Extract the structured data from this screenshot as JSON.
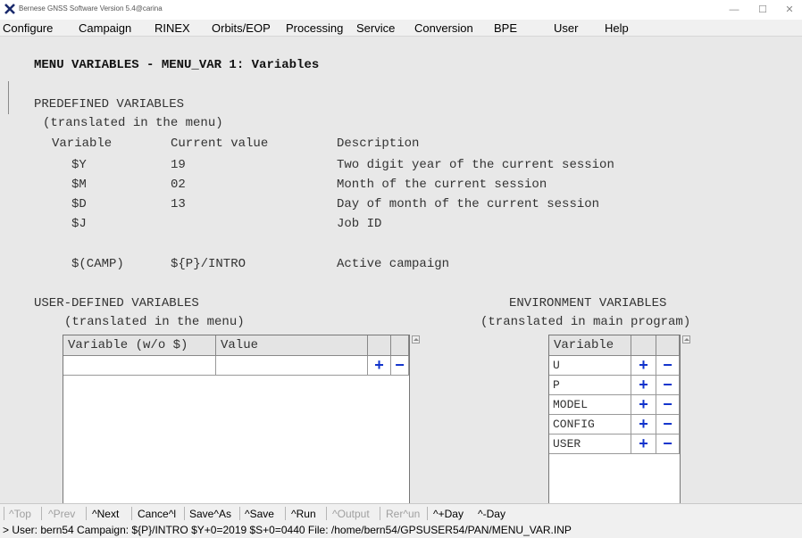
{
  "window": {
    "title": "Bernese GNSS Software Version 5.4@carina",
    "minimize": "—",
    "maximize": "☐",
    "close": "✕"
  },
  "menu": [
    "Configure",
    "Campaign",
    "RINEX",
    "Orbits/EOP",
    "Processing",
    "Service",
    "Conversion",
    "BPE",
    "User",
    "Help"
  ],
  "panel": {
    "title": "MENU VARIABLES - MENU_VAR 1: Variables",
    "predefined": {
      "heading": "PREDEFINED VARIABLES",
      "subheading": "(translated in the menu)",
      "col_variable": "Variable",
      "col_value": "Current value",
      "col_description": "Description",
      "rows": [
        {
          "variable": "$Y",
          "value": "19",
          "description": "Two digit year of the current session"
        },
        {
          "variable": "$M",
          "value": "02",
          "description": "Month of the current session"
        },
        {
          "variable": "$D",
          "value": "13",
          "description": "Day of month of the current session"
        },
        {
          "variable": "$J",
          "value": "",
          "description": "Job ID"
        },
        {
          "variable": "$(CAMP)",
          "value": "${P}/INTRO",
          "description": "Active campaign"
        }
      ]
    },
    "user_defined": {
      "heading": "USER-DEFINED VARIABLES",
      "subheading": "(translated in the menu)",
      "col_variable": "Variable (w/o $)",
      "col_value": "Value",
      "rows": [
        {
          "variable": "",
          "value": ""
        }
      ]
    },
    "environment": {
      "heading": "ENVIRONMENT VARIABLES",
      "subheading": "(translated in main program)",
      "col_variable": "Variable",
      "rows": [
        "U",
        "P",
        "MODEL",
        "CONFIG",
        "USER"
      ]
    },
    "add_symbol": "+",
    "remove_symbol": "−"
  },
  "statusbar": {
    "buttons": [
      {
        "label": "^Top",
        "enabled": false
      },
      {
        "label": "^Prev",
        "enabled": false
      },
      {
        "label": "^Next",
        "enabled": true
      },
      {
        "label": "Cance^l",
        "enabled": true
      },
      {
        "label": "Save^As",
        "enabled": true
      },
      {
        "label": "^Save",
        "enabled": true
      },
      {
        "label": "^Run",
        "enabled": true
      },
      {
        "label": "^Output",
        "enabled": false
      },
      {
        "label": "Rer^un",
        "enabled": false
      },
      {
        "label": "^+Day",
        "enabled": true
      },
      {
        "label": "^-Day",
        "enabled": true
      }
    ]
  },
  "infobar": {
    "text": "> User: bern54  Campaign: ${P}/INTRO  $Y+0=2019  $S+0=0440  File: /home/bern54/GPSUSER54/PAN/MENU_VAR.INP"
  }
}
